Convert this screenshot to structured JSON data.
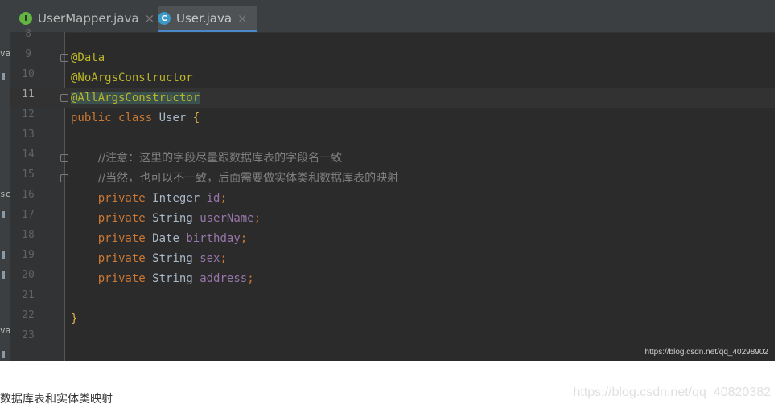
{
  "tabs": [
    {
      "label": "UserMapper.java",
      "icon": "interface-icon",
      "icon_letter": "I",
      "active": false,
      "close": "×"
    },
    {
      "label": "User.java",
      "icon": "class-icon",
      "icon_letter": "C",
      "active": true,
      "close": "×"
    }
  ],
  "left_strip": {
    "marks": [
      "va",
      "sc",
      "va"
    ]
  },
  "editor": {
    "current_line": "11",
    "lines": [
      {
        "num": "8"
      },
      {
        "num": "9",
        "parts": [
          "@Data"
        ]
      },
      {
        "num": "10",
        "parts": [
          "@NoArgsConstructor"
        ]
      },
      {
        "num": "11",
        "parts": [
          "@AllArgsConstructor"
        ]
      },
      {
        "num": "12",
        "parts": [
          "public",
          "class",
          "User",
          "{"
        ]
      },
      {
        "num": "13"
      },
      {
        "num": "14",
        "parts": [
          "//注意：这里的字段尽量跟数据库表的字段名一致"
        ]
      },
      {
        "num": "15",
        "parts": [
          "//当然，也可以不一致，后面需要做实体类和数据库表的映射"
        ]
      },
      {
        "num": "16",
        "parts": [
          "private",
          "Integer",
          "id",
          ";"
        ]
      },
      {
        "num": "17",
        "parts": [
          "private",
          "String",
          "userName",
          ";"
        ]
      },
      {
        "num": "18",
        "parts": [
          "private",
          "Date",
          "birthday",
          ";"
        ]
      },
      {
        "num": "19",
        "parts": [
          "private",
          "String",
          "sex",
          ";"
        ]
      },
      {
        "num": "20",
        "parts": [
          "private",
          "String",
          "address",
          ";"
        ]
      },
      {
        "num": "21"
      },
      {
        "num": "22",
        "parts": [
          "}"
        ]
      },
      {
        "num": "23"
      }
    ]
  },
  "watermark_inner": "https://blog.csdn.net/qq_40298902",
  "caption": "数据库表和实体类映射",
  "watermark_outer": "https://blog.csdn.net/qq_40820382",
  "colors": {
    "background": "#2b2b2b",
    "keyword": "#cc7832",
    "annotation": "#bbb529",
    "field": "#9876aa",
    "comment": "#808080",
    "tab_underline": "#4a88c7"
  }
}
